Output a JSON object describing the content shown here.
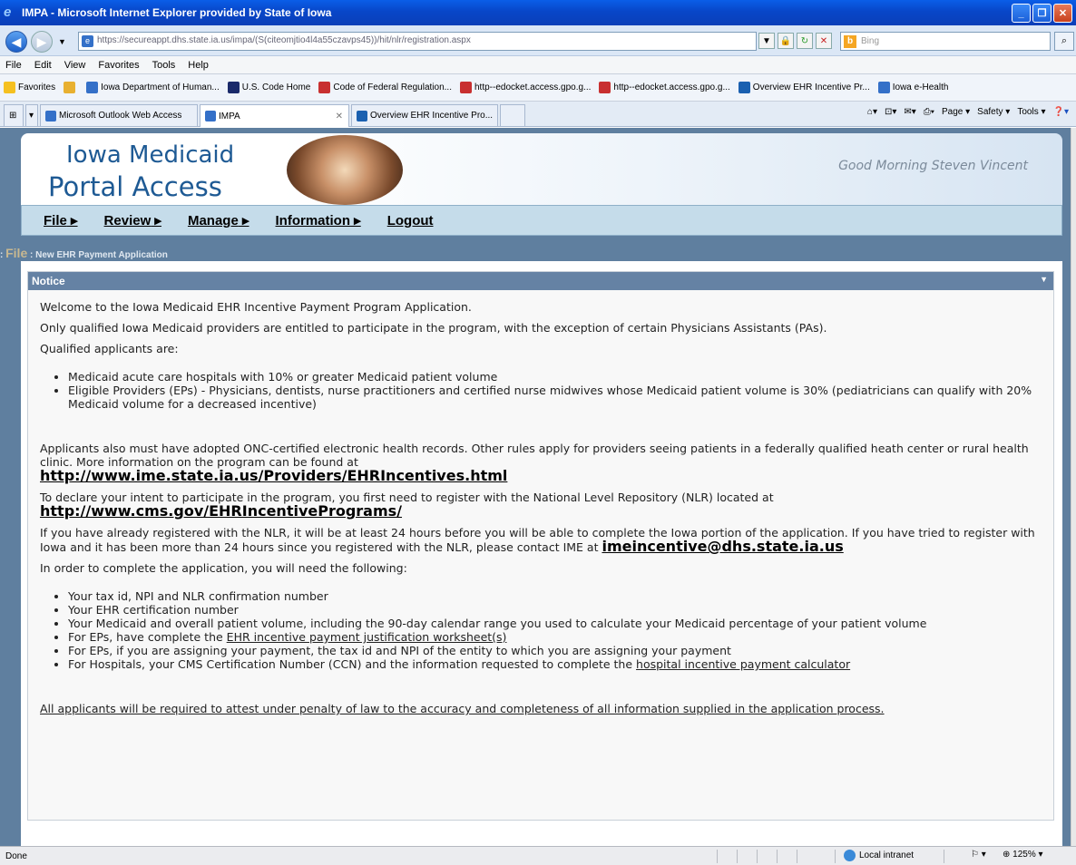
{
  "window": {
    "title": "IMPA - Microsoft Internet Explorer provided by State of Iowa"
  },
  "address": {
    "url": "https://secureappt.dhs.state.ia.us/impa/(S(citeomjtio4l4a55czavps45))/hit/nlr/registration.aspx",
    "search_placeholder": "Bing"
  },
  "menu": [
    "File",
    "Edit",
    "View",
    "Favorites",
    "Tools",
    "Help"
  ],
  "favorites": {
    "label": "Favorites",
    "items": [
      "Iowa Department of Human...",
      "U.S. Code Home",
      "Code of Federal Regulation...",
      "http--edocket.access.gpo.g...",
      "http--edocket.access.gpo.g...",
      "Overview EHR Incentive Pr...",
      "Iowa e-Health"
    ]
  },
  "tabs": [
    "Microsoft Outlook Web Access",
    "IMPA",
    "Overview EHR Incentive Pro..."
  ],
  "commands": [
    "Page",
    "Safety",
    "Tools"
  ],
  "banner": {
    "line1": "Iowa Medicaid",
    "line2": "Portal Access",
    "greeting": "Good Morning Steven Vincent"
  },
  "nav": [
    "File",
    "Review",
    "Manage",
    "Information",
    "Logout"
  ],
  "breadcrumb": {
    "prefix": ": ",
    "section": "File",
    "page": " : New EHR Payment Application"
  },
  "notice": {
    "header": "Notice",
    "intro": "Welcome to the Iowa Medicaid EHR Incentive Payment Program Application.",
    "p1": "Only qualified Iowa Medicaid providers are entitled to participate in the program, with the exception of certain Physicians Assistants (PAs).",
    "p2": "Qualified applicants are:",
    "qualified": [
      "Medicaid acute care hospitals with 10% or greater Medicaid patient volume",
      "Eligible Providers (EPs) - Physicians, dentists, nurse practitioners and certified nurse midwives whose Medicaid patient volume is 30% (pediatricians can qualify with 20% Medicaid volume for a decreased incentive)"
    ],
    "p3": "Applicants also must have adopted ONC-certified electronic health records. Other rules apply for providers seeing patients in a federally qualified heath center or rural health clinic. More information on the program can be found at",
    "link1": "http://www.ime.state.ia.us/Providers/EHRIncentives.html",
    "p4": "To declare your intent to participate in the program, you first need to register with the National Level Repository (NLR) located at",
    "link2": "http://www.cms.gov/EHRIncentivePrograms/",
    "p5": "If you have already registered with the NLR, it will be at least 24 hours before you will be able to complete the Iowa portion of the application. If you have tried to register with Iowa and it has been more than 24 hours since you registered with the NLR, please contact IME at",
    "email": "imeincentive@dhs.state.ia.us",
    "p6": "In order to complete the application, you will need the following:",
    "need1": "Your tax id, NPI and NLR confirmation number",
    "need2": "Your EHR certification number",
    "need3": "Your Medicaid and overall patient volume, including the 90-day calendar range you used to calculate your Medicaid percentage of your patient volume",
    "need4_pre": "For EPs, have complete the ",
    "need4_link": "EHR incentive payment justification worksheet(s)",
    "need5": "For EPs, if you are assigning your payment, the tax id and NPI of the entity to which you are assigning your payment",
    "need6_pre": "For Hospitals, your CMS Certification Number (CCN) and the information requested to complete the ",
    "need6_link": "hospital incentive payment calculator",
    "attest": "All applicants will be required to attest under penalty of law to the accuracy and completeness of all information supplied in the application process."
  },
  "status": {
    "left": "Done",
    "zone": "Local intranet",
    "zoom": "125%"
  }
}
